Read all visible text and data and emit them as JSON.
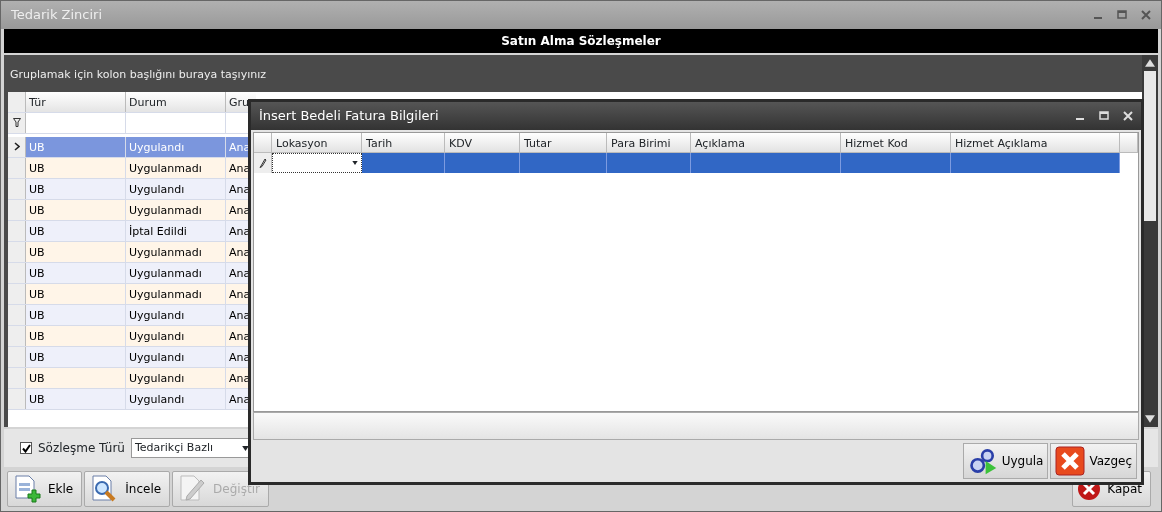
{
  "window": {
    "title": "Tedarik Zinciri"
  },
  "header": "Satın Alma Sözleşmeler",
  "group_panel": "Gruplamak için kolon başlığını buraya taşıyınız",
  "table": {
    "columns": [
      "Tür",
      "Durum",
      "Gru"
    ],
    "rows": [
      {
        "cells": [
          "UB",
          "Uygulandı",
          "Ana"
        ],
        "selected": true
      },
      {
        "cells": [
          "UB",
          "Uygulanmadı",
          "Ana"
        ],
        "selected": false
      },
      {
        "cells": [
          "UB",
          "Uygulandı",
          "Ana"
        ],
        "selected": false
      },
      {
        "cells": [
          "UB",
          "Uygulanmadı",
          "Ana"
        ],
        "selected": false
      },
      {
        "cells": [
          "UB",
          "İptal Edildi",
          "Ana"
        ],
        "selected": false
      },
      {
        "cells": [
          "UB",
          "Uygulanmadı",
          "Ana"
        ],
        "selected": false
      },
      {
        "cells": [
          "UB",
          "Uygulanmadı",
          "Ana"
        ],
        "selected": false
      },
      {
        "cells": [
          "UB",
          "Uygulanmadı",
          "Ana"
        ],
        "selected": false
      },
      {
        "cells": [
          "UB",
          "Uygulandı",
          "Ana"
        ],
        "selected": false
      },
      {
        "cells": [
          "UB",
          "Uygulandı",
          "Ana"
        ],
        "selected": false
      },
      {
        "cells": [
          "UB",
          "Uygulandı",
          "Ana"
        ],
        "selected": false
      },
      {
        "cells": [
          "UB",
          "Uygulandı",
          "Ana"
        ],
        "selected": false
      },
      {
        "cells": [
          "UB",
          "Uygulandı",
          "Ana"
        ],
        "selected": false
      }
    ]
  },
  "filter": {
    "checkbox": {
      "label": "Sözleşme Türü",
      "checked": true
    },
    "combo": {
      "value": "Tedarikçi Bazlı"
    }
  },
  "toolbar": [
    {
      "label": "Ekle",
      "kind": "add",
      "disabled": false
    },
    {
      "label": "İncele",
      "kind": "view",
      "disabled": false
    },
    {
      "label": "Değiştir",
      "kind": "edit",
      "disabled": true
    }
  ],
  "close_button": {
    "label": "Kapat"
  },
  "dialog": {
    "title": "İnsert Bedeli Fatura Bilgileri",
    "columns": [
      "Lokasyon",
      "Tarih",
      "KDV",
      "Tutar",
      "Para Birimi",
      "Açıklama",
      "Hizmet Kod",
      "Hizmet Açıklama"
    ],
    "buttons": [
      {
        "label": "Uygula",
        "kind": "apply"
      },
      {
        "label": "Vazgeç",
        "kind": "cancel"
      }
    ]
  }
}
